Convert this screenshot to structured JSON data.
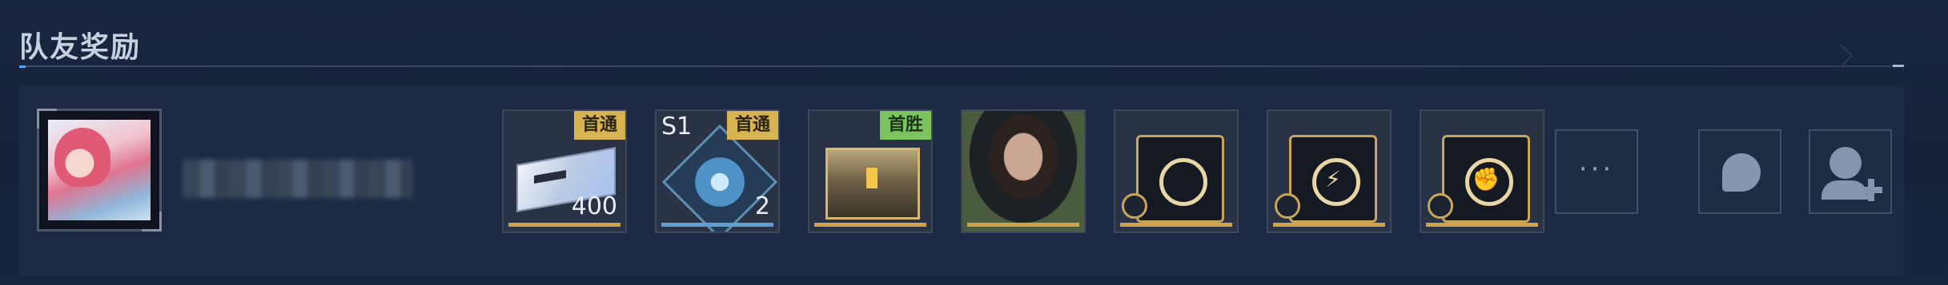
{
  "section": {
    "title": "队友奖励"
  },
  "player": {
    "name": "·"
  },
  "rewards": [
    {
      "tag": "首通",
      "count": "400"
    },
    {
      "tag": "首通",
      "season": "S1",
      "count": "2"
    },
    {
      "tag": "首胜"
    }
  ],
  "actions": {
    "more_label": "···"
  },
  "colors": {
    "accent": "#4fa3ff",
    "tag_gold": "#d7b451",
    "tag_green": "#7cc45e"
  }
}
